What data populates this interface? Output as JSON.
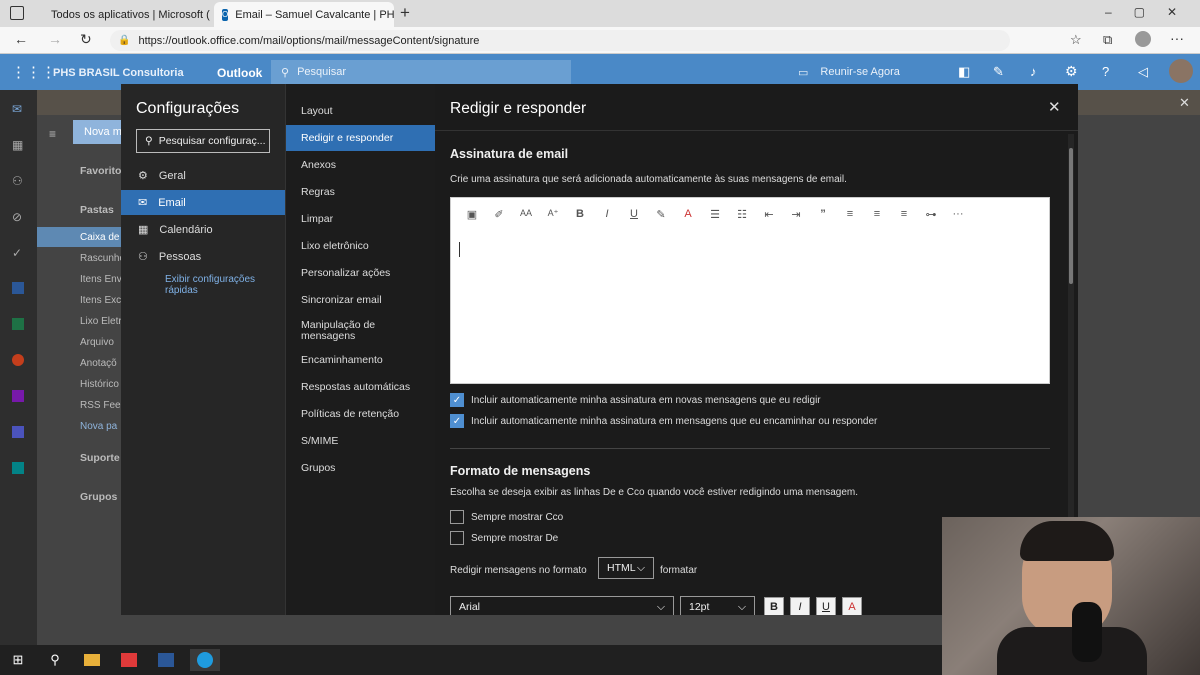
{
  "browser": {
    "tabs": [
      {
        "title": "Todos os aplicativos | Microsoft (",
        "icon": "office-icon"
      },
      {
        "title": "Email – Samuel Cavalcante | PHS",
        "icon": "outlook-icon"
      }
    ],
    "url": "https://outlook.office.com/mail/options/mail/messageContent/signature"
  },
  "outlook": {
    "org": "PHS BRASIL Consultoria",
    "app": "Outlook",
    "search_placeholder": "Pesquisar",
    "meet_now": "Reunir-se Agora"
  },
  "background": {
    "new_message": "Nova m",
    "favorites": "Favoritos",
    "folders": "Pastas",
    "folder_items": [
      "Caixa de",
      "Rascunho",
      "Itens Env",
      "Itens Exc",
      "Lixo Eletr",
      "Arquivo",
      "Anotaçõ",
      "Histórico",
      "RSS Feed",
      "Nova pa"
    ],
    "support": "Suporte",
    "groups": "Grupos"
  },
  "settings": {
    "title": "Configurações",
    "search_placeholder": "Pesquisar configuraç...",
    "categories": [
      "Geral",
      "Email",
      "Calendário",
      "Pessoas"
    ],
    "quick_settings": "Exibir configurações rápidas",
    "subcategories": [
      "Layout",
      "Redigir e responder",
      "Anexos",
      "Regras",
      "Limpar",
      "Lixo eletrônico",
      "Personalizar ações",
      "Sincronizar email",
      "Manipulação de mensagens",
      "Encaminhamento",
      "Respostas automáticas",
      "Políticas de retenção",
      "S/MIME",
      "Grupos"
    ]
  },
  "panel": {
    "title": "Redigir e responder",
    "signature": {
      "heading": "Assinatura de email",
      "description": "Crie uma assinatura que será adicionada automaticamente às suas mensagens de email.",
      "toolbar_more": "···",
      "opt_new": "Incluir automaticamente minha assinatura em novas mensagens que eu redigir",
      "opt_reply": "Incluir automaticamente minha assinatura em mensagens que eu encaminhar ou responder"
    },
    "format": {
      "heading": "Formato de mensagens",
      "description": "Escolha se deseja exibir as linhas De e Cco quando você estiver redigindo uma mensagem.",
      "always_bcc": "Sempre mostrar Cco",
      "always_from": "Sempre mostrar De",
      "compose_label": "Redigir mensagens no formato",
      "compose_value": "HTML",
      "compose_suffix": "formatar",
      "font": "Arial",
      "size": "12pt",
      "bold": "B",
      "italic": "I",
      "underline": "U",
      "color": "A"
    }
  },
  "colors": {
    "accent": "#2f6fb3",
    "header": "#4a89c7",
    "checkbox": "#4f8fd1"
  }
}
